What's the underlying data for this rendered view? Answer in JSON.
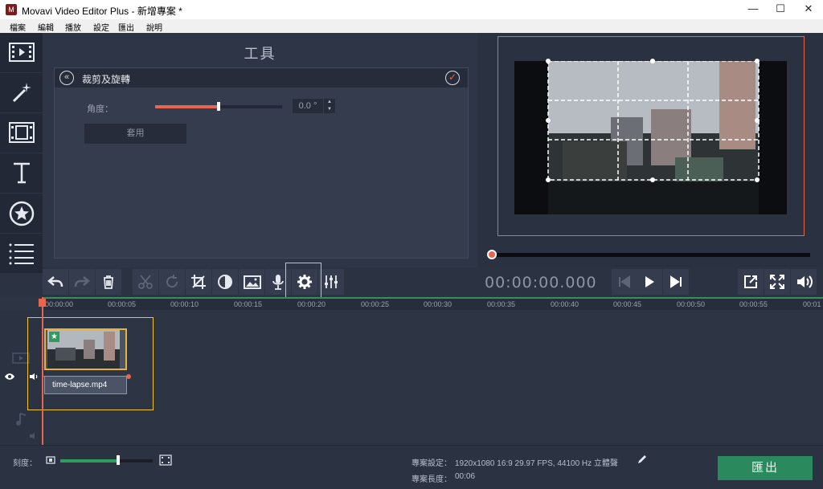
{
  "window": {
    "title": "Movavi Video Editor Plus - 新增專案 *",
    "logo_text": "M",
    "minimize_glyph": "—",
    "maximize_glyph": "☐",
    "close_glyph": "✕"
  },
  "menu": [
    "檔案",
    "編輯",
    "播放",
    "設定",
    "匯出",
    "說明"
  ],
  "tools_panel": {
    "title": "工具",
    "crop": {
      "title": "裁剪及旋轉",
      "angle_label": "角度：",
      "angle_value": "0.0 °",
      "angle_fraction": 0.5,
      "apply_label": "套用"
    }
  },
  "preview": {
    "timecode": "00:00:00.000",
    "seek_position": 0.0
  },
  "timeline": {
    "ticks": [
      "00:00:00",
      "00:00:05",
      "00:00:10",
      "00:00:15",
      "00:00:20",
      "00:00:25",
      "00:00:30",
      "00:00:35",
      "00:00:40",
      "00:00:45",
      "00:00:50",
      "00:00:55",
      "00:01"
    ],
    "clip_name": "time-lapse.mp4"
  },
  "status": {
    "zoom_label": "刻度：",
    "zoom_fraction": 0.63,
    "settings_label": "專案設定：",
    "settings_value": "1920x1080 16:9 29.97 FPS, 44100 Hz 立體聲",
    "length_label": "專案長度：",
    "length_value": "00:06",
    "export_label": "匯出"
  },
  "colors": {
    "accent": "#e8654f",
    "export_green": "#2a8a5d",
    "highlight": "#f2c232",
    "clip_border": "#e9b33a"
  }
}
